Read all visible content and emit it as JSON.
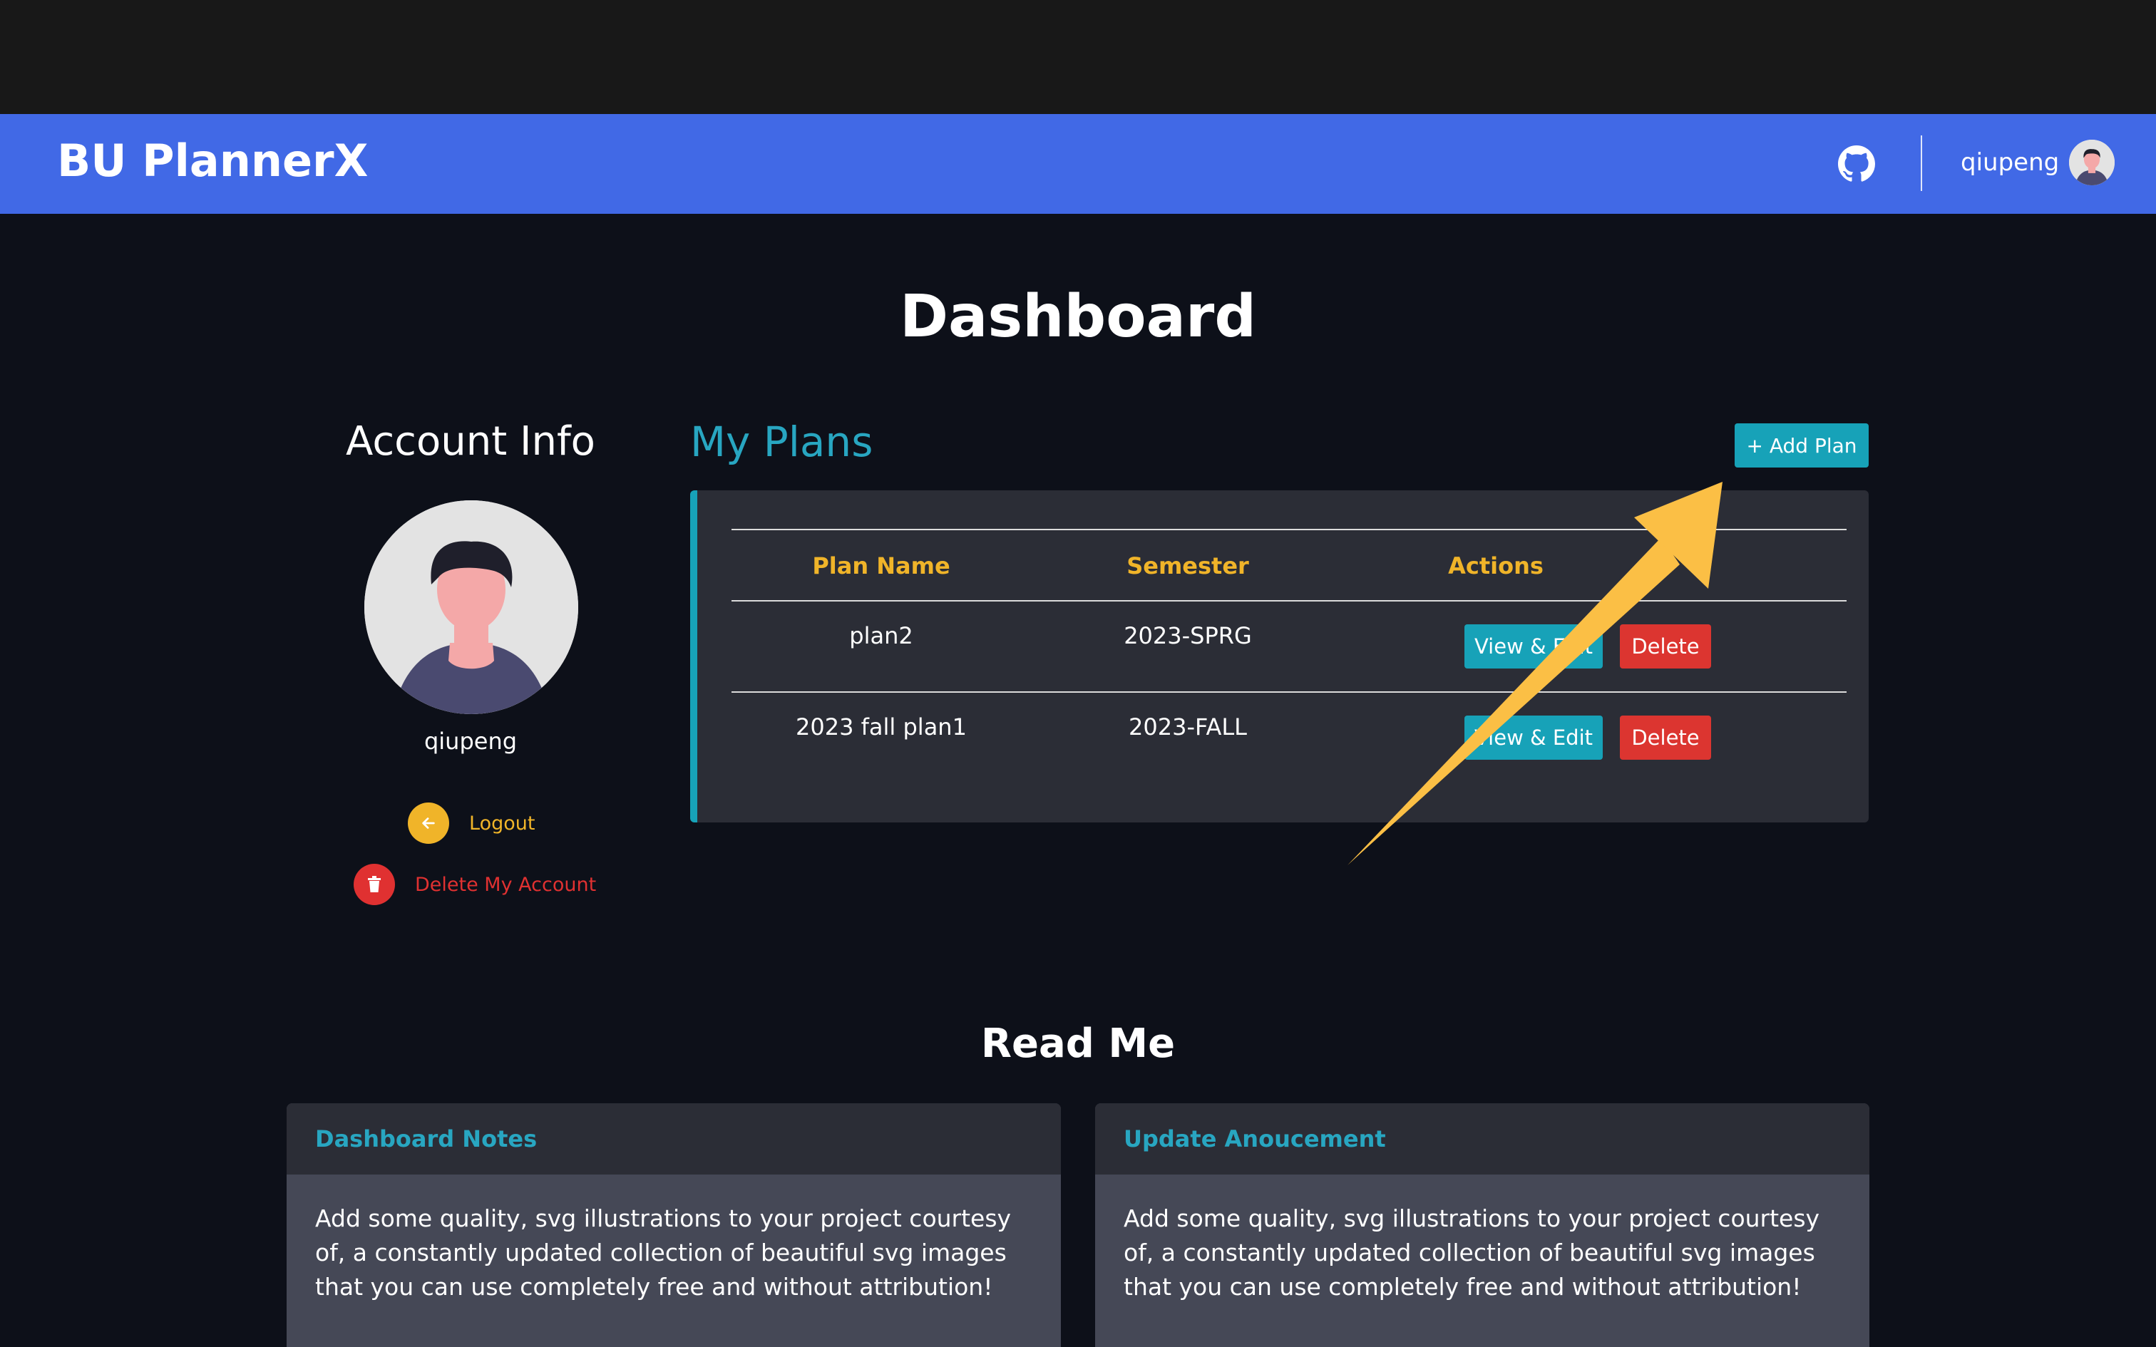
{
  "app": {
    "brand": "BU PlannerX",
    "github_icon": "github-icon",
    "username": "qiupeng"
  },
  "page": {
    "title": "Dashboard"
  },
  "account": {
    "title": "Account Info",
    "username": "qiupeng",
    "logout_label": "Logout",
    "logout_icon": "arrow-left-icon",
    "delete_label": "Delete My Account",
    "delete_icon": "trash-icon"
  },
  "plans": {
    "title": "My Plans",
    "add_label": "+ Add Plan",
    "columns": [
      "Plan Name",
      "Semester",
      "Actions"
    ],
    "rows": [
      {
        "name": "plan2",
        "semester": "2023-SPRG",
        "view_label": "View & Edit",
        "delete_label": "Delete"
      },
      {
        "name": "2023 fall plan1",
        "semester": "2023-FALL",
        "view_label": "View & Edit",
        "delete_label": "Delete"
      }
    ]
  },
  "readme": {
    "title": "Read Me",
    "cards": [
      {
        "title": "Dashboard Notes",
        "body": "Add some quality, svg illustrations to your project courtesy of, a constantly updated collection of beautiful svg images that you can use completely free and without attribution!"
      },
      {
        "title": "Update Anoucement",
        "body": "Add some quality, svg illustrations to your project courtesy of, a constantly updated collection of beautiful svg images that you can use completely free and without attribution!"
      }
    ]
  },
  "colors": {
    "navbar": "#4169e6",
    "background": "#0d1019",
    "accent_teal": "#17a2b8",
    "accent_yellow": "#f0b429",
    "danger": "#dc3530",
    "annotation_arrow": "#fbbf45"
  }
}
